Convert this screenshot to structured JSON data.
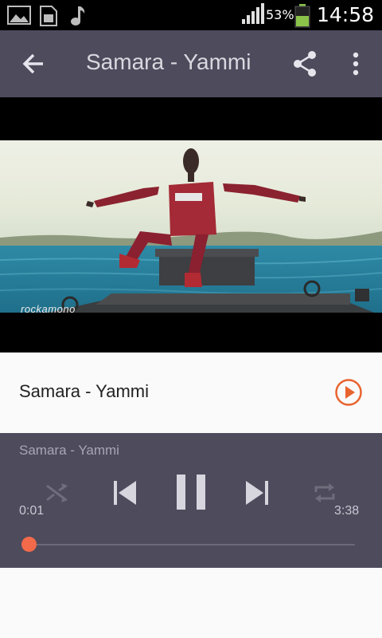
{
  "status_bar": {
    "battery_percent": "53%",
    "battery_level": 0.53,
    "time": "14:58",
    "icons": [
      "image-icon",
      "sim-card-icon",
      "music-note-icon",
      "signal-icon",
      "battery-icon"
    ]
  },
  "toolbar": {
    "title": "Samara - Yammi"
  },
  "video": {
    "watermark": "rockamono"
  },
  "track": {
    "title": "Samara - Yammi"
  },
  "player": {
    "now_playing": "Samara - Yammi",
    "elapsed": "0:01",
    "duration": "3:38",
    "progress": 0.005
  },
  "colors": {
    "toolbar": "#4d4b5c",
    "accent": "#e8642e",
    "seek_thumb": "#f26a4a"
  }
}
